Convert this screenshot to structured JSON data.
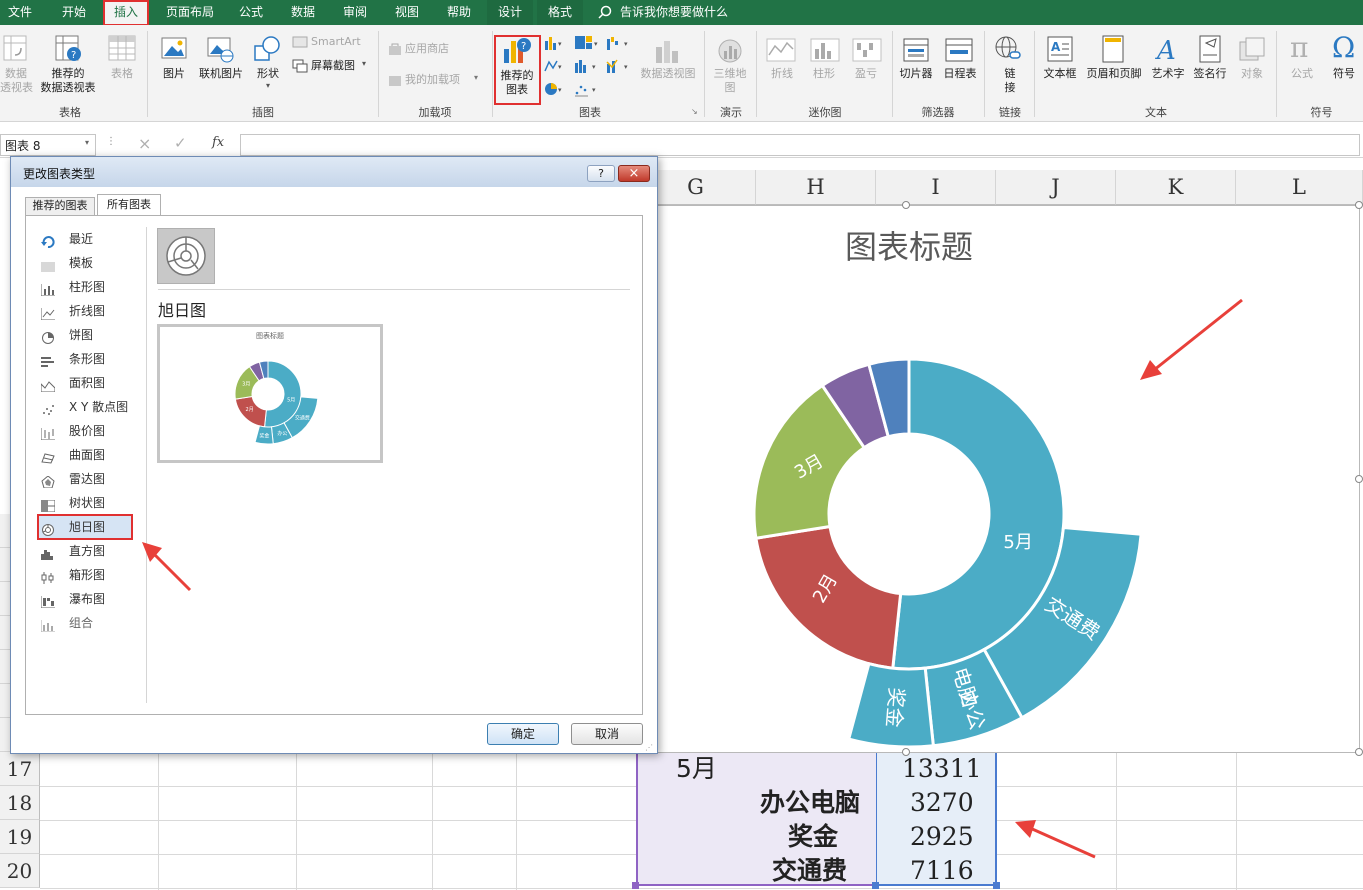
{
  "tabs": [
    "文件",
    "开始",
    "插入",
    "页面布局",
    "公式",
    "数据",
    "审阅",
    "视图",
    "帮助",
    "设计",
    "格式"
  ],
  "tell_me": "告诉我你想要做什么",
  "ribbon": {
    "tables": {
      "pivot": "数据\n透视表",
      "recommended_pivot": "推荐的\n数据透视表",
      "table": "表格",
      "group": "表格"
    },
    "illustrations": {
      "picture": "图片",
      "online_picture": "联机图片",
      "shapes": "形状",
      "smartart": "SmartArt",
      "screenshot": "屏幕截图",
      "group": "插图"
    },
    "addins": {
      "store": "应用商店",
      "my_addins": "我的加载项",
      "group": "加载项"
    },
    "charts": {
      "recommended": "推荐的\n图表",
      "pivot_chart": "数据透视图",
      "group": "图表"
    },
    "tours": {
      "map3d": "三维地\n图",
      "group": "演示"
    },
    "sparklines": {
      "line": "折线",
      "column": "柱形",
      "winloss": "盈亏",
      "group": "迷你图"
    },
    "filters": {
      "slicer": "切片器",
      "timeline": "日程表",
      "group": "筛选器"
    },
    "links": {
      "link": "链\n接",
      "group": "链接"
    },
    "text": {
      "textbox": "文本框",
      "header_footer": "页眉和页脚",
      "wordart": "艺术字",
      "signature": "签名行",
      "object": "对象",
      "group": "文本"
    },
    "symbols": {
      "equation": "公式",
      "symbol": "符号",
      "group": "符号"
    }
  },
  "formula_bar": {
    "name_box": "图表 8",
    "fx": "fx",
    "cancel": "×",
    "enter": "✓"
  },
  "columns": [
    "G",
    "H",
    "I",
    "J",
    "K",
    "L"
  ],
  "rows": [
    "1",
    "1",
    "1",
    "1",
    "1",
    "1",
    "1",
    "1",
    "1",
    "17",
    "18",
    "19",
    "20"
  ],
  "dialog": {
    "title": "更改图表类型",
    "help": "?",
    "close": "×",
    "tabs": [
      "推荐的图表",
      "所有图表"
    ],
    "list": [
      "最近",
      "模板",
      "柱形图",
      "折线图",
      "饼图",
      "条形图",
      "面积图",
      "X Y 散点图",
      "股价图",
      "曲面图",
      "雷达图",
      "树状图",
      "旭日图",
      "直方图",
      "箱形图",
      "瀑布图",
      "组合"
    ],
    "selected": "旭日图",
    "preview_title": "旭日图",
    "thumb_title": "图表标题",
    "thumb_labels": [
      "3月",
      "5月",
      "交通费",
      "2月",
      "办公",
      "奖金"
    ],
    "ok": "确定",
    "cancel": "取消"
  },
  "cells": [
    {
      "label": "5月",
      "value": "13311"
    },
    {
      "label": "办公电脑",
      "value": "3270"
    },
    {
      "label": "奖金",
      "value": "2925"
    },
    {
      "label": "交通费",
      "value": "7116"
    }
  ],
  "chart_data": {
    "type": "sunburst",
    "title": "图表标题",
    "inner": [
      {
        "name": "5月",
        "color": "#4bacc6"
      },
      {
        "name": "2月",
        "color": "#c0504d"
      },
      {
        "name": "3月",
        "color": "#9bbb59"
      },
      {
        "name": "",
        "color": "#8064a2"
      },
      {
        "name": "",
        "color": "#4f81bd"
      }
    ],
    "outer": [
      {
        "name": "交通费",
        "value": 7116,
        "parent": "5月"
      },
      {
        "name": "办公电脑",
        "value": 3270,
        "parent": "5月"
      },
      {
        "name": "奖金",
        "value": 2925,
        "parent": "5月"
      }
    ]
  },
  "colors": {
    "excel_green": "#217346",
    "highlight_red": "#e03030"
  }
}
